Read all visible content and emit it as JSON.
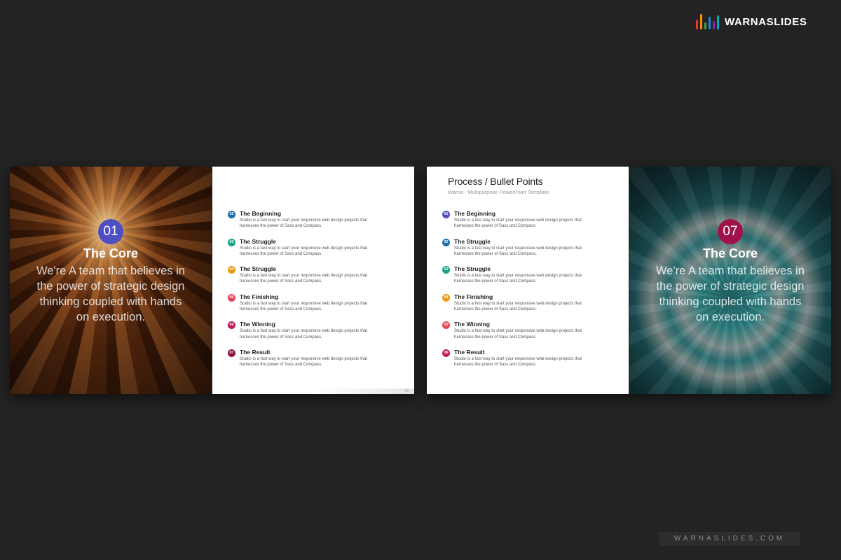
{
  "brand": {
    "name": "WARNASLIDES",
    "logo_colors": [
      "#e53935",
      "#fb8c00",
      "#43a047",
      "#1e88e5",
      "#8e24aa",
      "#00acc1"
    ]
  },
  "slide_left": {
    "badge_number": "01",
    "badge_color": "#4f4fc4",
    "overlay_title": "The Core",
    "overlay_body": "We're A team that believes in the power of strategic design thinking coupled with hands on execution.",
    "page_number": "23",
    "items": [
      {
        "num": "02",
        "color": "#1b6fa8",
        "title": "The Beginning",
        "desc": "Studio is a fast way to start your responsive web design projects that harnesses the power of Sass and Compass."
      },
      {
        "num": "03",
        "color": "#16a38a",
        "title": "The Struggle",
        "desc": "Studio is a fast way to start your responsive web design projects that harnesses the power of Sass and Compass."
      },
      {
        "num": "04",
        "color": "#e89b13",
        "title": "The Struggle",
        "desc": "Studio is a fast way to start your responsive web design projects that harnesses the power of Sass and Compass."
      },
      {
        "num": "05",
        "color": "#e8435a",
        "title": "The Finishing",
        "desc": "Studio is a fast way to start your responsive web design projects that harnesses the power of Sass and Compass."
      },
      {
        "num": "06",
        "color": "#c2185b",
        "title": "The Winning",
        "desc": "Studio is a fast way to start your responsive web design projects that harnesses the power of Sass and Compass."
      },
      {
        "num": "07",
        "color": "#8b1538",
        "title": "The Result",
        "desc": "Studio is a fast way to start your responsive web design projects that harnesses the power of Sass and Compass."
      }
    ]
  },
  "slide_right": {
    "title": "Process / Bullet Points",
    "subtitle": "Warna - Multipurpose PowerPoint Template",
    "badge_number": "07",
    "badge_color": "#a0134a",
    "overlay_title": "The Core",
    "overlay_body": "We're A team that believes in the power of strategic design thinking coupled with hands on execution.",
    "items": [
      {
        "num": "01",
        "color": "#4f4fc4",
        "title": "The Beginning",
        "desc": "Studio is a fast way to start your responsive web design projects that harnesses the power of Sass and Compass."
      },
      {
        "num": "02",
        "color": "#1b6fa8",
        "title": "The Struggle",
        "desc": "Studio is a fast way to start your responsive web design projects that harnesses the power of Sass and Compass."
      },
      {
        "num": "03",
        "color": "#16a38a",
        "title": "The Struggle",
        "desc": "Studio is a fast way to start your responsive web design projects that harnesses the power of Sass and Compass."
      },
      {
        "num": "04",
        "color": "#e89b13",
        "title": "The Finishing",
        "desc": "Studio is a fast way to start your responsive web design projects that harnesses the power of Sass and Compass."
      },
      {
        "num": "05",
        "color": "#e8435a",
        "title": "The Winning",
        "desc": "Studio is a fast way to start your responsive web design projects that harnesses the power of Sass and Compass."
      },
      {
        "num": "06",
        "color": "#c2185b",
        "title": "The Result",
        "desc": "Studio is a fast way to start your responsive web design projects that harnesses the power of Sass and Compass."
      }
    ]
  },
  "watermark": "WARNASLIDES.COM"
}
